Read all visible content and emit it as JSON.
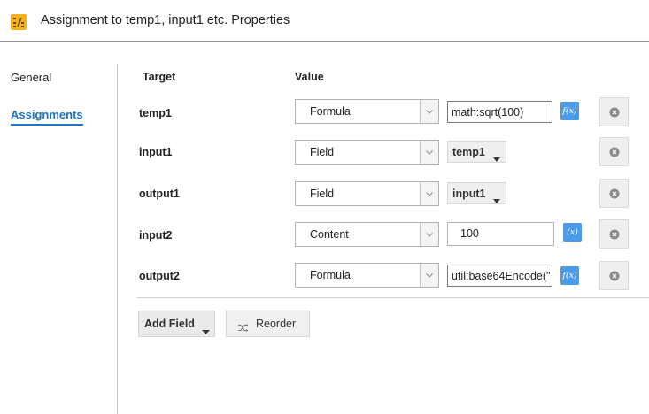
{
  "header": {
    "title": "Assignment to temp1, input1 etc. Properties",
    "icon": "assignment-icon",
    "icon_color": "#f2b21c"
  },
  "nav": {
    "items": [
      {
        "label": "General",
        "active": false
      },
      {
        "label": "Assignments",
        "active": true
      }
    ],
    "active_color": "#1c75c8"
  },
  "columns": {
    "target": "Target",
    "value": "Value"
  },
  "rows": [
    {
      "target": "temp1",
      "type": "Formula",
      "value": "math:sqrt(100)",
      "fx": "f(x)"
    },
    {
      "target": "input1",
      "type": "Field",
      "value": "temp1"
    },
    {
      "target": "output1",
      "type": "Field",
      "value": "input1"
    },
    {
      "target": "input2",
      "type": "Content",
      "value": "100",
      "fx": "(x)"
    },
    {
      "target": "output2",
      "type": "Formula",
      "value": "util:base64Encode(\"",
      "fx": "f(x)"
    }
  ],
  "buttons": {
    "add_field": "Add Field",
    "reorder": "Reorder"
  },
  "colors": {
    "fx_button": "#4a9be8",
    "delete_icon": "#8a8a8a"
  }
}
